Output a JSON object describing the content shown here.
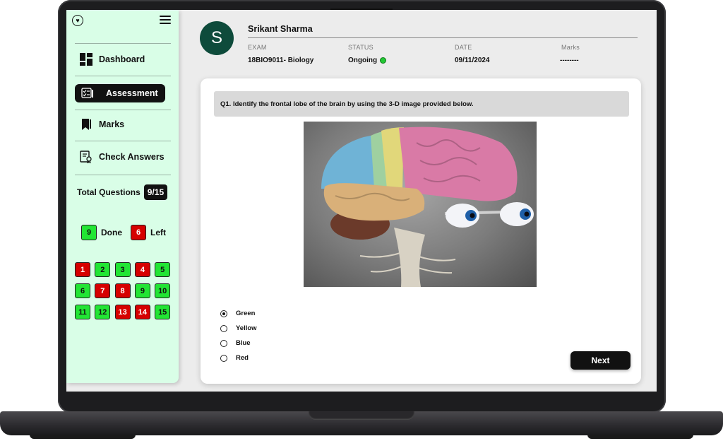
{
  "sidebar": {
    "logo_glyph": "♥",
    "nav": [
      {
        "label": "Dashboard",
        "icon": "dashboard-icon"
      },
      {
        "label": "Assessment",
        "icon": "assessment-icon",
        "active": true
      },
      {
        "label": "Marks",
        "icon": "bookmark-icon"
      },
      {
        "label": "Check Answers",
        "icon": "certificate-icon"
      }
    ],
    "total_label": "Total Questions",
    "total_value": "9/15",
    "done_count": "9",
    "done_label": "Done",
    "left_count": "6",
    "left_label": "Left",
    "questions": [
      {
        "n": "1",
        "status": "red"
      },
      {
        "n": "2",
        "status": "green"
      },
      {
        "n": "3",
        "status": "green"
      },
      {
        "n": "4",
        "status": "red"
      },
      {
        "n": "5",
        "status": "green"
      },
      {
        "n": "6",
        "status": "green"
      },
      {
        "n": "7",
        "status": "red"
      },
      {
        "n": "8",
        "status": "red"
      },
      {
        "n": "9",
        "status": "green"
      },
      {
        "n": "10",
        "status": "green"
      },
      {
        "n": "11",
        "status": "green"
      },
      {
        "n": "12",
        "status": "green"
      },
      {
        "n": "13",
        "status": "red"
      },
      {
        "n": "14",
        "status": "red"
      },
      {
        "n": "15",
        "status": "green"
      }
    ]
  },
  "header": {
    "avatar_letter": "S",
    "user_name": "Srikant Sharma",
    "columns": [
      {
        "label": "EXAM",
        "value": "18BIO9011- Biology"
      },
      {
        "label": "STATUS",
        "value": "Ongoing"
      },
      {
        "label": "DATE",
        "value": "09/11/2024"
      },
      {
        "label": "Marks",
        "value": "--------"
      }
    ]
  },
  "question": {
    "text": "Q1.  Identify the frontal lobe of the brain by using the 3-D image provided below.",
    "options": [
      "Green",
      "Yellow",
      "Blue",
      "Red"
    ],
    "selected_index": 0,
    "next_label": "Next"
  },
  "colors": {
    "sidebar_bg": "#d9fee7",
    "done_green": "#22e534",
    "left_red": "#d60000",
    "avatar_bg": "#0e4b3b",
    "status_dot": "#23c834"
  }
}
